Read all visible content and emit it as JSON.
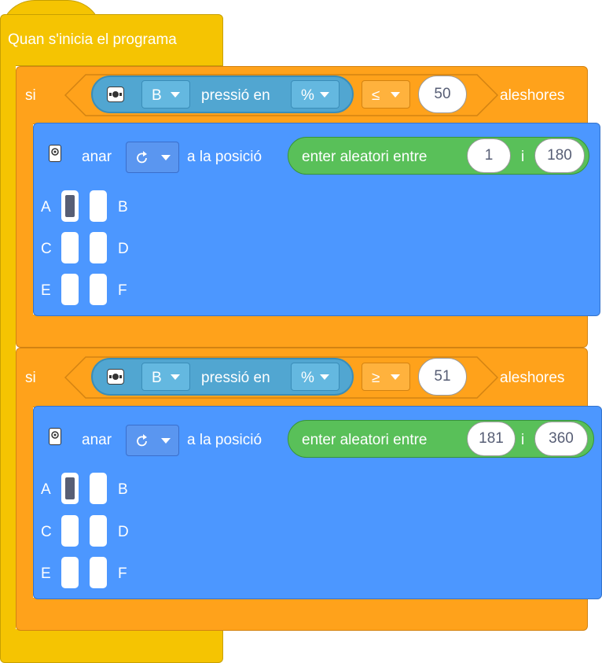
{
  "event_block": {
    "label": "Quan s'inicia el programa"
  },
  "if_blocks": [
    {
      "keyword": "si",
      "then_label": "aleshores",
      "sensor": {
        "port": "B",
        "label": "pressió en",
        "unit": "%"
      },
      "operator": "≤",
      "value": "50",
      "motor": {
        "verb": "anar",
        "direction_icon": "clockwise-arrow-icon",
        "position_label": "a la posició",
        "random": {
          "label": "enter aleatori entre",
          "min": "1",
          "joiner": "i",
          "max": "180"
        },
        "ports": [
          "A",
          "B",
          "C",
          "D",
          "E",
          "F"
        ],
        "selected_port": "A"
      }
    },
    {
      "keyword": "si",
      "then_label": "aleshores",
      "sensor": {
        "port": "B",
        "label": "pressió en",
        "unit": "%"
      },
      "operator": "≥",
      "value": "51",
      "motor": {
        "verb": "anar",
        "direction_icon": "clockwise-arrow-icon",
        "position_label": "a la posició",
        "random": {
          "label": "enter aleatori entre",
          "min": "181",
          "joiner": "i",
          "max": "360"
        },
        "ports": [
          "A",
          "B",
          "C",
          "D",
          "E",
          "F"
        ],
        "selected_port": "A"
      }
    }
  ],
  "colors": {
    "event": "#F5C402",
    "control": "#FFA21B",
    "sensor": "#51A6D1",
    "motor": "#4C97FF",
    "operator": "#59C059"
  }
}
